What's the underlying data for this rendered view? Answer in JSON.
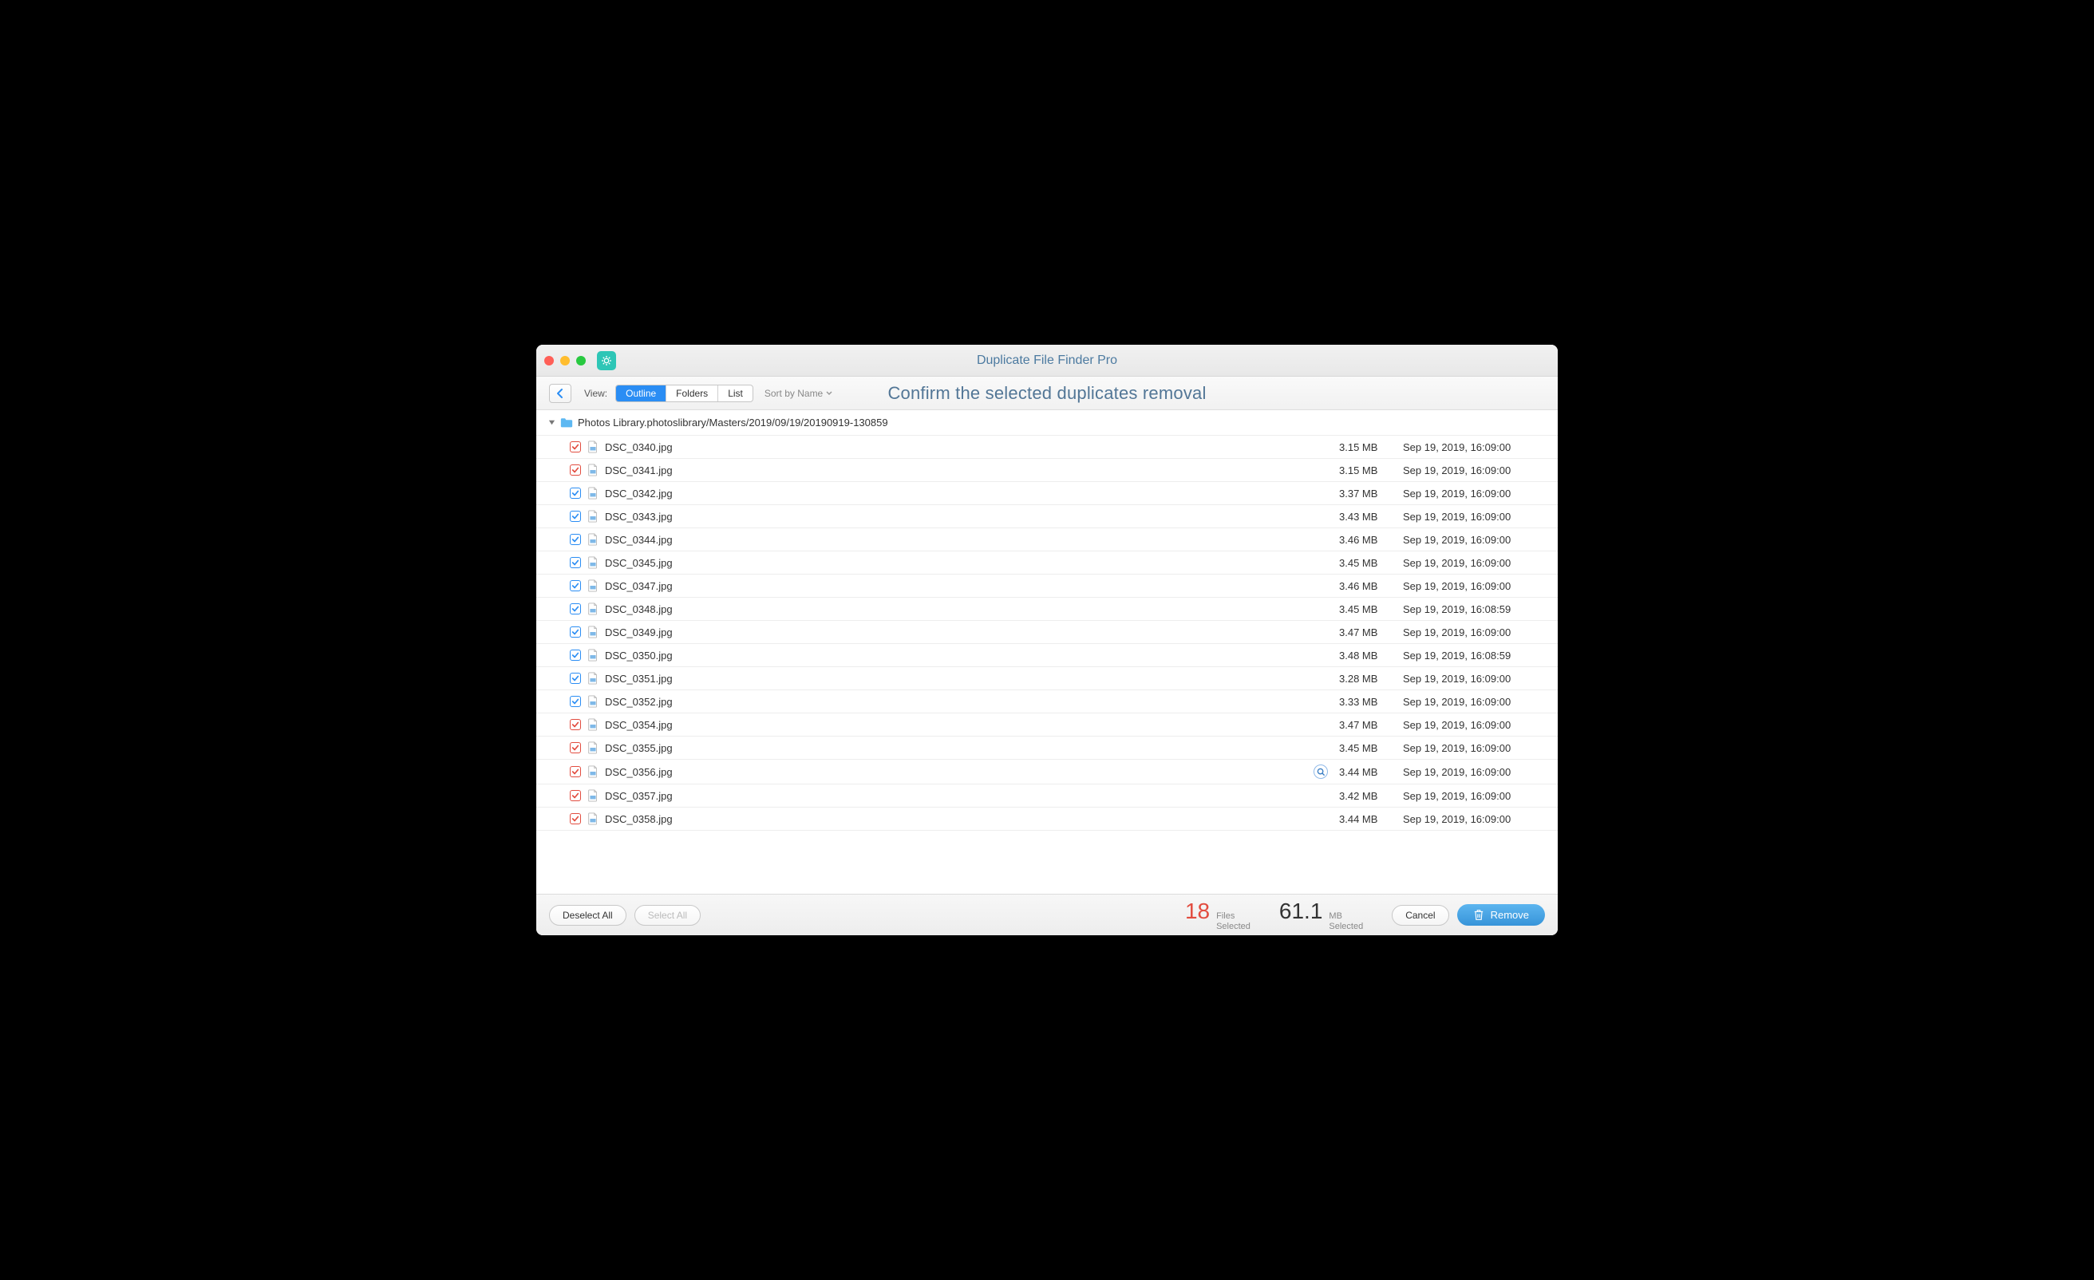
{
  "titlebar": {
    "title": "Duplicate File Finder Pro"
  },
  "toolbar": {
    "view_label": "View:",
    "seg": {
      "outline": "Outline",
      "folders": "Folders",
      "list": "List"
    },
    "sort_label": "Sort by Name",
    "heading": "Confirm the selected duplicates removal"
  },
  "group": {
    "path": "Photos Library.photoslibrary/Masters/2019/09/19/20190919-130859"
  },
  "files": [
    {
      "name": "DSC_0340.jpg",
      "size": "3.15 MB",
      "date": "Sep 19, 2019, 16:09:00",
      "color": "red",
      "ql": false
    },
    {
      "name": "DSC_0341.jpg",
      "size": "3.15 MB",
      "date": "Sep 19, 2019, 16:09:00",
      "color": "red",
      "ql": false
    },
    {
      "name": "DSC_0342.jpg",
      "size": "3.37 MB",
      "date": "Sep 19, 2019, 16:09:00",
      "color": "blue",
      "ql": false
    },
    {
      "name": "DSC_0343.jpg",
      "size": "3.43 MB",
      "date": "Sep 19, 2019, 16:09:00",
      "color": "blue",
      "ql": false
    },
    {
      "name": "DSC_0344.jpg",
      "size": "3.46 MB",
      "date": "Sep 19, 2019, 16:09:00",
      "color": "blue",
      "ql": false
    },
    {
      "name": "DSC_0345.jpg",
      "size": "3.45 MB",
      "date": "Sep 19, 2019, 16:09:00",
      "color": "blue",
      "ql": false
    },
    {
      "name": "DSC_0347.jpg",
      "size": "3.46 MB",
      "date": "Sep 19, 2019, 16:09:00",
      "color": "blue",
      "ql": false
    },
    {
      "name": "DSC_0348.jpg",
      "size": "3.45 MB",
      "date": "Sep 19, 2019, 16:08:59",
      "color": "blue",
      "ql": false
    },
    {
      "name": "DSC_0349.jpg",
      "size": "3.47 MB",
      "date": "Sep 19, 2019, 16:09:00",
      "color": "blue",
      "ql": false
    },
    {
      "name": "DSC_0350.jpg",
      "size": "3.48 MB",
      "date": "Sep 19, 2019, 16:08:59",
      "color": "blue",
      "ql": false
    },
    {
      "name": "DSC_0351.jpg",
      "size": "3.28 MB",
      "date": "Sep 19, 2019, 16:09:00",
      "color": "blue",
      "ql": false
    },
    {
      "name": "DSC_0352.jpg",
      "size": "3.33 MB",
      "date": "Sep 19, 2019, 16:09:00",
      "color": "blue",
      "ql": false
    },
    {
      "name": "DSC_0354.jpg",
      "size": "3.47 MB",
      "date": "Sep 19, 2019, 16:09:00",
      "color": "red",
      "ql": false
    },
    {
      "name": "DSC_0355.jpg",
      "size": "3.45 MB",
      "date": "Sep 19, 2019, 16:09:00",
      "color": "red",
      "ql": false
    },
    {
      "name": "DSC_0356.jpg",
      "size": "3.44 MB",
      "date": "Sep 19, 2019, 16:09:00",
      "color": "red",
      "ql": true
    },
    {
      "name": "DSC_0357.jpg",
      "size": "3.42 MB",
      "date": "Sep 19, 2019, 16:09:00",
      "color": "red",
      "ql": false
    },
    {
      "name": "DSC_0358.jpg",
      "size": "3.44 MB",
      "date": "Sep 19, 2019, 16:09:00",
      "color": "red",
      "ql": false
    }
  ],
  "bottom": {
    "deselect_all": "Deselect All",
    "select_all": "Select All",
    "files_count": "18",
    "files_label_top": "Files",
    "files_label_bottom": "Selected",
    "size_total": "61.1",
    "size_label_top": "MB",
    "size_label_bottom": "Selected",
    "cancel": "Cancel",
    "remove": "Remove"
  }
}
